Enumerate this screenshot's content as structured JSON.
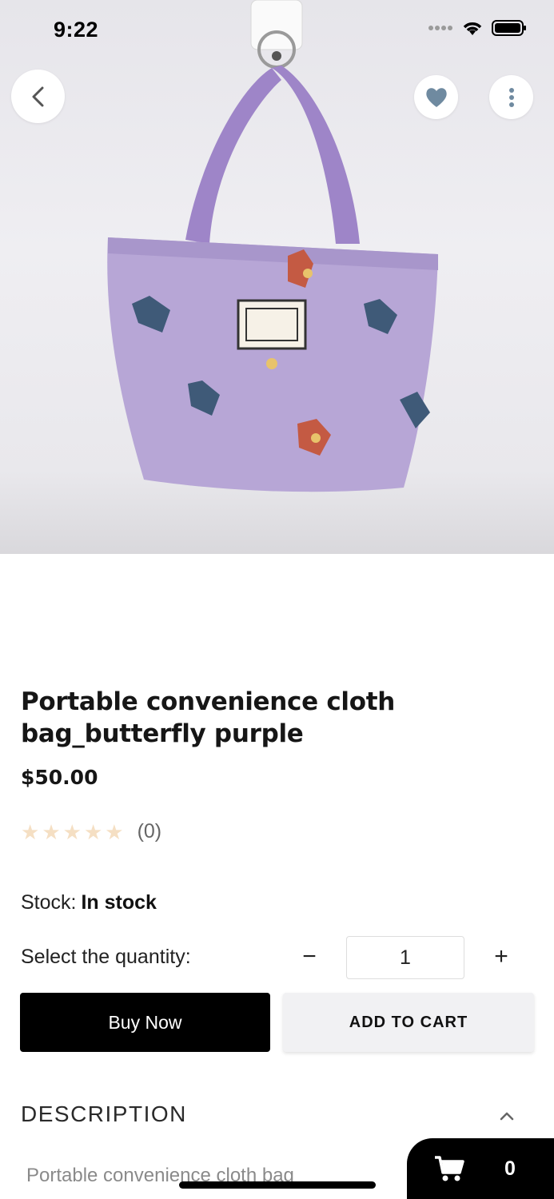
{
  "status_bar": {
    "time": "9:22"
  },
  "product": {
    "title": "Portable convenience cloth bag_butterfly purple",
    "price": "$50.00",
    "rating_count": "(0)",
    "stars": 5,
    "stock_label": "Stock:",
    "stock_value": "In stock",
    "quantity_label": "Select the quantity:",
    "quantity": "1",
    "minus_symbol": "−",
    "plus_symbol": "+"
  },
  "actions": {
    "buy_now": "Buy Now",
    "add_to_cart": "ADD TO CART"
  },
  "description": {
    "header": "DESCRIPTION",
    "text": "Portable convenience cloth bag"
  },
  "cart": {
    "count": "0"
  },
  "icons": {
    "back": "chevron-left-icon",
    "favorite": "heart-icon",
    "more": "more-vertical-icon",
    "cart": "shopping-cart-icon",
    "collapse": "chevron-up-icon"
  },
  "colors": {
    "bag": "#b7a6d6",
    "buy_button": "#000000",
    "cart_button": "#f1f1f3",
    "star_empty": "#f5dfc3",
    "favorite_icon": "#6f8aa0"
  }
}
